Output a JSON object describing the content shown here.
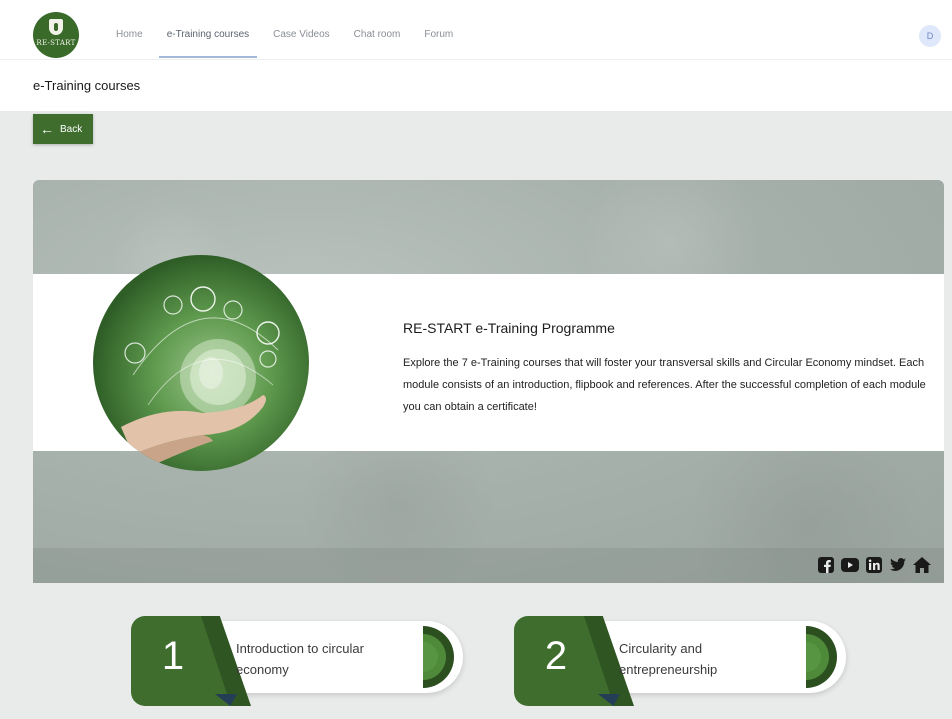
{
  "nav": {
    "logo_text": "RE-START",
    "items": [
      {
        "label": "Home",
        "active": false
      },
      {
        "label": "e-Training courses",
        "active": true
      },
      {
        "label": "Case Videos",
        "active": false
      },
      {
        "label": "Chat room",
        "active": false
      },
      {
        "label": "Forum",
        "active": false
      }
    ],
    "avatar_initial": "D"
  },
  "page": {
    "title": "e-Training courses",
    "back_label": "Back"
  },
  "hero": {
    "heading": "RE-START e-Training Programme",
    "description": "Explore the 7 e-Training courses that will foster your transversal skills and Circular Economy mindset. Each module consists of an introduction, flipbook and references. After the successful completion of each module you can obtain a certificate!",
    "social_icons": [
      "facebook-icon",
      "youtube-icon",
      "linkedin-icon",
      "twitter-icon",
      "home-icon"
    ]
  },
  "modules": [
    {
      "number": "1",
      "title": "Introduction to circular economy"
    },
    {
      "number": "2",
      "title": "Circularity and entrepreneurship"
    }
  ],
  "colors": {
    "brand_green": "#3e6d2d",
    "nav_active_underline": "#a3b7d9",
    "content_background": "#e9ebea"
  }
}
